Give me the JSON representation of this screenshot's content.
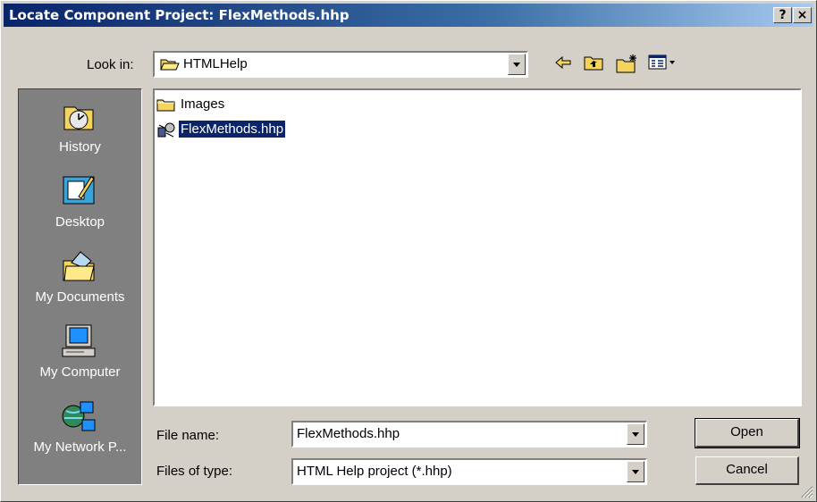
{
  "window": {
    "title": "Locate Component Project: FlexMethods.hhp",
    "help_button": "?",
    "close_button": "×"
  },
  "look_in": {
    "label": "Look in:",
    "value": "HTMLHelp"
  },
  "places": [
    {
      "label": "History",
      "icon": "history-icon"
    },
    {
      "label": "Desktop",
      "icon": "desktop-icon"
    },
    {
      "label": "My Documents",
      "icon": "my-documents-icon"
    },
    {
      "label": "My Computer",
      "icon": "my-computer-icon"
    },
    {
      "label": "My Network P...",
      "icon": "network-places-icon"
    }
  ],
  "files": [
    {
      "name": "Images",
      "icon": "folder-icon",
      "selected": false
    },
    {
      "name": "FlexMethods.hhp",
      "icon": "hhp-file-icon",
      "selected": true
    }
  ],
  "file_name": {
    "label": "File name:",
    "value": "FlexMethods.hhp"
  },
  "file_type": {
    "label": "Files of type:",
    "value": "HTML Help project (*.hhp)"
  },
  "buttons": {
    "open": "Open",
    "cancel": "Cancel"
  },
  "colors": {
    "title_gradient_start": "#0a246a",
    "selection": "#0a246a",
    "places_bar": "#808080",
    "dialog_face": "#d4d0c8"
  }
}
